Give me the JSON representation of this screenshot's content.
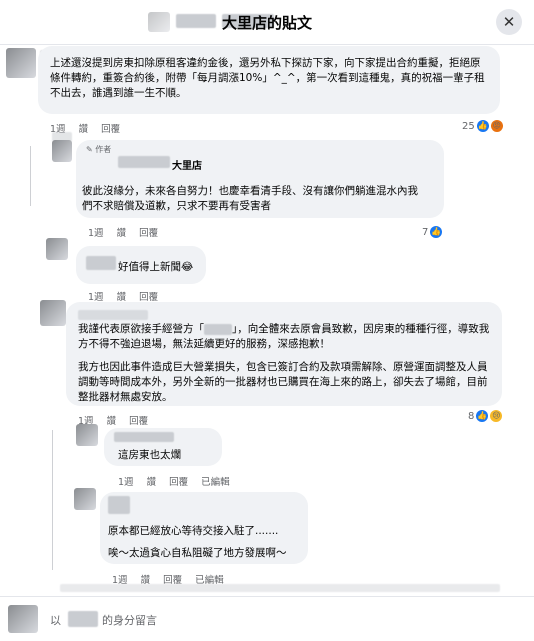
{
  "header": {
    "title": "大里店的貼文",
    "close_icon": "close-icon"
  },
  "comments": [
    {
      "text": "上述還沒提到房東扣除原租客違約金後，還另外私下探訪下家，向下家提出合約重擬，拒絕原條件轉約，重簽合約後，附帶「每月調漲10%」^_^，第一次看到這種鬼，真的祝福一輩子租不出去，誰遇到誰一生不順。",
      "time": "1週",
      "like": "讚",
      "reply": "回覆",
      "reaction_count": "25"
    },
    {
      "author_badge": "作者",
      "name": "大里店",
      "text": "彼此沒緣分，未來各自努力！也慶幸看清手段、沒有讓你們躺進混水內我們不求賠償及道歉，只求不要再有受害者",
      "time": "1週",
      "like": "讚",
      "reply": "回覆",
      "reaction_count": "7"
    },
    {
      "text": "好值得上新聞😂",
      "time": "1週",
      "like": "讚",
      "reply": "回覆"
    },
    {
      "text1": "我謹代表原欲接手經營方「",
      "text1b": "」，向全體來去原會員致歉，因房東的種種行徑，導致我方不得不強迫退場，無法延續更好的服務，深感抱歉！",
      "text2": "我方也因此事件造成巨大營業損失，包含已簽訂合約及款項需解除、原營運面調整及人員調動等時間成本外，另外全新的一批器材也已購買在海上來的路上，卻失去了場館，目前整批器材無處安放。",
      "time": "1週",
      "like": "讚",
      "reply": "回覆",
      "reaction_count": "8"
    },
    {
      "text": "這房東也太爛",
      "time": "1週",
      "like": "讚",
      "reply": "回覆",
      "edited": "已編輯"
    },
    {
      "text1": "原本都已經放心等待交接入駐了.......",
      "text2": "唉～太過貪心自私阻礙了地方發展啊～",
      "time": "1週",
      "like": "讚",
      "reply": "回覆",
      "edited": "已編輯"
    }
  ],
  "composer": {
    "prefix": "以",
    "suffix": "的身分留言"
  }
}
